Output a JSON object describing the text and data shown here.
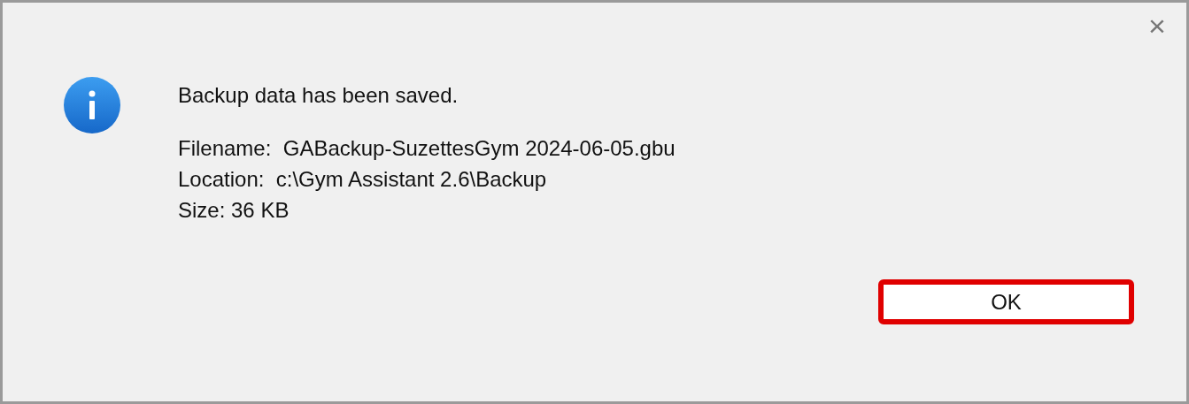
{
  "dialog": {
    "close_label": "×",
    "message": "Backup data has been saved.",
    "details": [
      "Filename:  GABackup-SuzettesGym 2024-06-05.gbu",
      "Location:  c:\\Gym Assistant 2.6\\Backup",
      "Size: 36 KB"
    ],
    "button": {
      "label": "OK",
      "highlighted": true
    }
  }
}
